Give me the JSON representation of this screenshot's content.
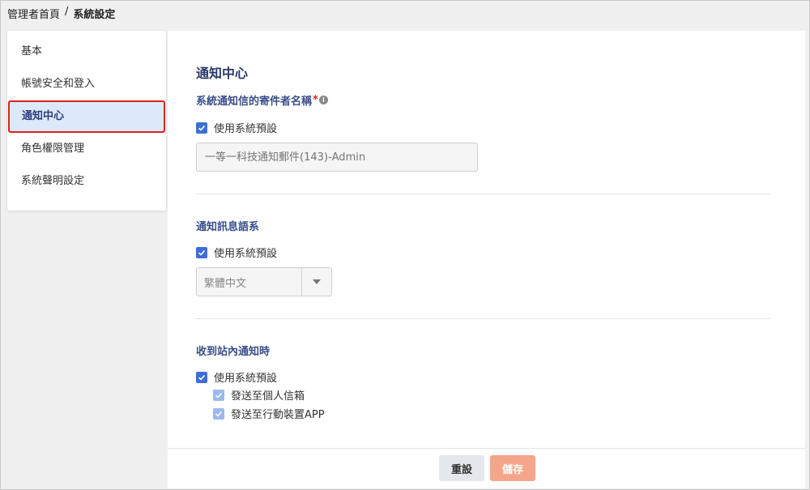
{
  "breadcrumb": {
    "home": "管理者首頁",
    "separator": "/",
    "current": "系統設定"
  },
  "sidebar": {
    "items": [
      {
        "label": "基本"
      },
      {
        "label": "帳號安全和登入"
      },
      {
        "label": "通知中心"
      },
      {
        "label": "角色權限管理"
      },
      {
        "label": "系統聲明設定"
      }
    ]
  },
  "main": {
    "section_title": "通知中心",
    "sender": {
      "label": "系統通知信的寄件者名稱",
      "required_mark": "*",
      "info_icon": "i",
      "checkbox_label": "使用系統預設",
      "input_placeholder": "一等一科技通知郵件(143)-Admin"
    },
    "language": {
      "label": "通知訊息語系",
      "checkbox_label": "使用系統預設",
      "selected": "繁體中文"
    },
    "site_notice": {
      "label": "收到站內通知時",
      "checkbox_label": "使用系統預設",
      "sub_options": [
        "發送至個人信箱",
        "發送至行動裝置APP"
      ]
    }
  },
  "footer": {
    "reset_label": "重設",
    "save_label": "儲存"
  },
  "colors": {
    "accent": "#3b6fd6",
    "save_button": "#f5a58a",
    "active_border": "#e02020"
  }
}
